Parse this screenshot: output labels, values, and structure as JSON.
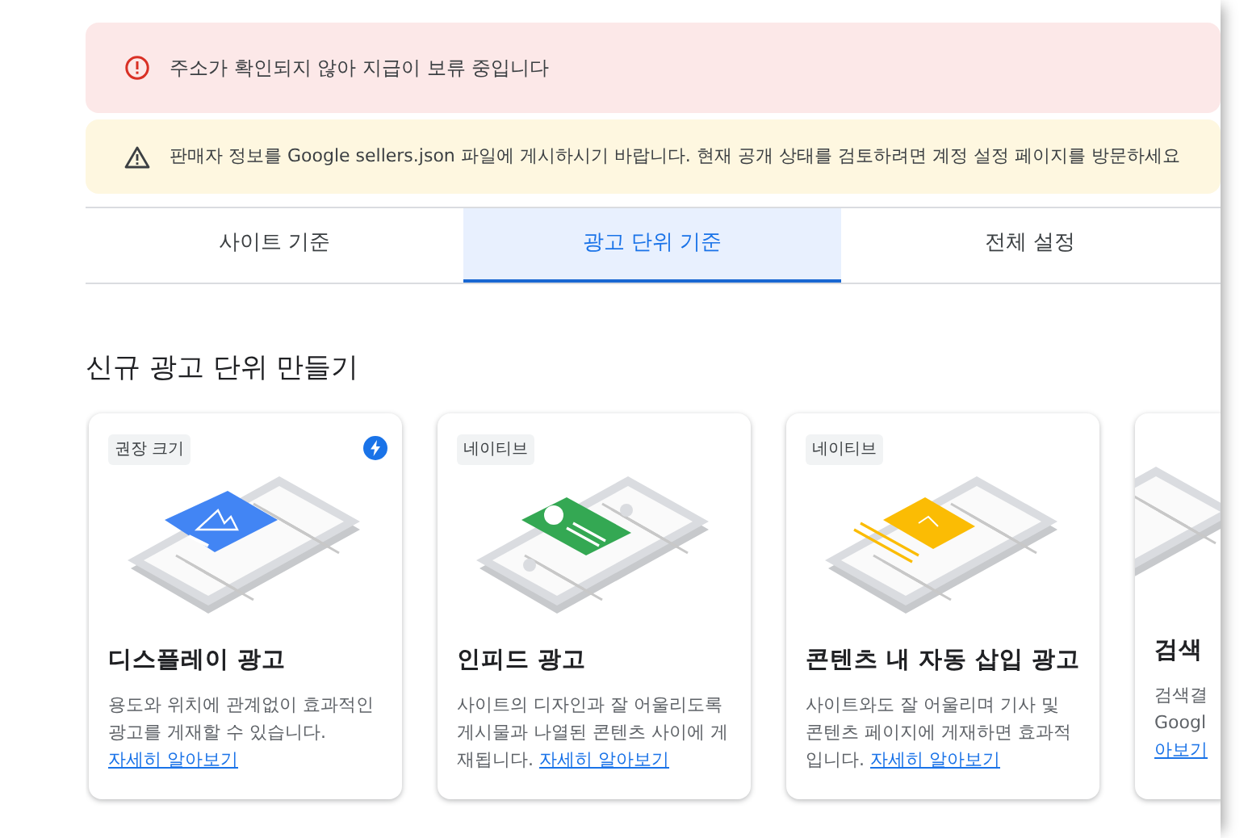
{
  "alerts": [
    {
      "kind": "error",
      "text": "주소가 확인되지 않아 지급이 보류 중입니다"
    },
    {
      "kind": "warning",
      "text": "판매자 정보를 Google sellers.json 파일에 게시하시기 바랍니다. 현재 공개 상태를 검토하려면 계정 설정 페이지를 방문하세요"
    }
  ],
  "tabs": [
    {
      "label": "사이트 기준",
      "selected": false
    },
    {
      "label": "광고 단위 기준",
      "selected": true
    },
    {
      "label": "전체 설정",
      "selected": false
    }
  ],
  "section_title": "신규 광고 단위 만들기",
  "cards": [
    {
      "kind": "display",
      "tag": "권장 크기",
      "recommended": true,
      "title": "디스플레이 광고",
      "description": "용도와 위치에 관계없이 효과적인 광고를 게재할 수 있습니다.",
      "link": "자세히 알아보기"
    },
    {
      "kind": "infeed",
      "tag": "네이티브",
      "recommended": false,
      "title": "인피드 광고",
      "description": "사이트의 디자인과 잘 어울리도록 게시물과 나열된 콘텐츠 사이에 게재됩니다.",
      "link": "자세히 알아보기"
    },
    {
      "kind": "inarticle",
      "tag": "네이티브",
      "recommended": false,
      "title": "콘텐츠 내 자동 삽입 광고",
      "description": "사이트와도 잘 어울리며 기사 및 콘텐츠 페이지에 게재하면 효과적입니다.",
      "link": "자세히 알아보기"
    },
    {
      "kind": "search",
      "title": "검색",
      "description": "검색결\nGoogl",
      "link": "아보기"
    }
  ]
}
